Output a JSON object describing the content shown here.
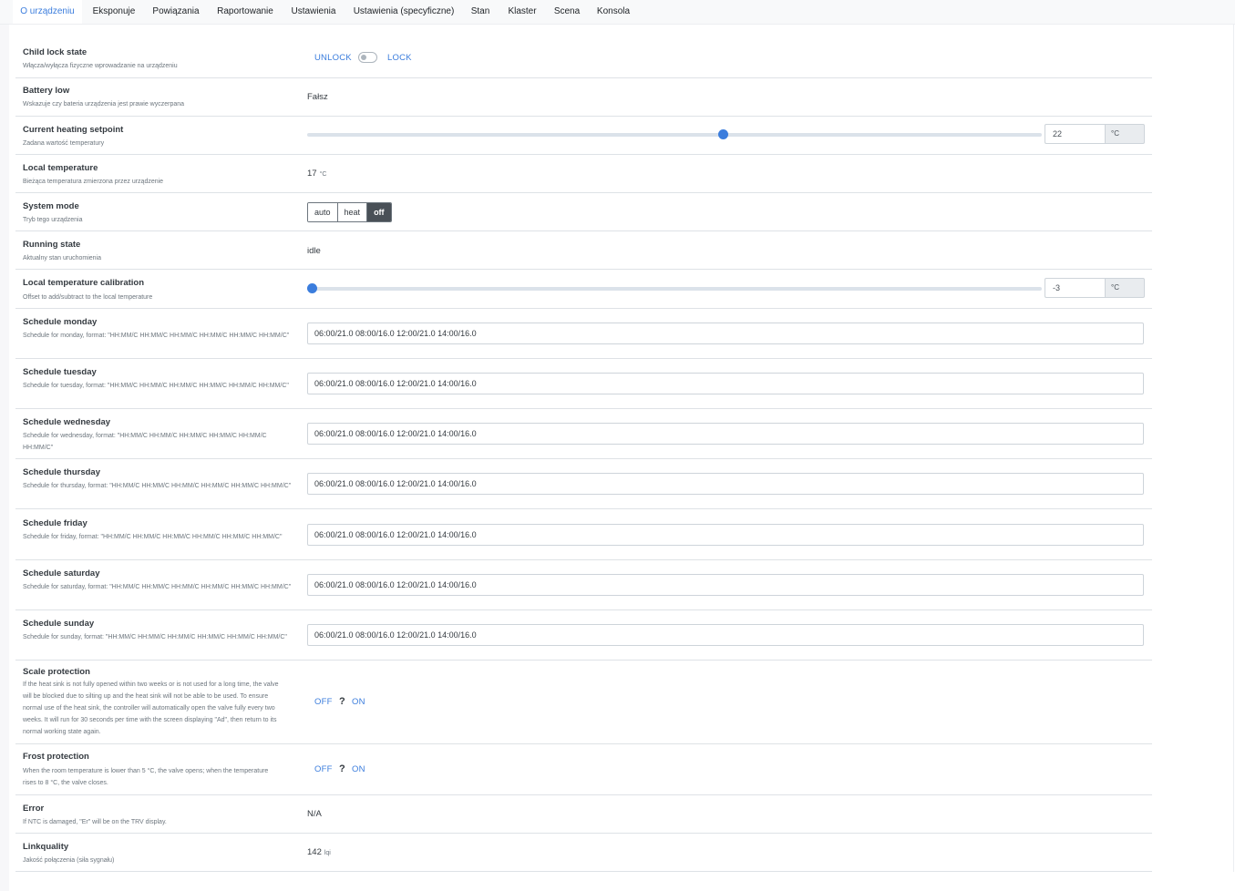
{
  "tabs": [
    "O urządzeniu",
    "Eksponuje",
    "Powiązania",
    "Raportowanie",
    "Ustawienia",
    "Ustawienia (specyficzne)",
    "Stan",
    "Klaster",
    "Scena",
    "Konsola"
  ],
  "active_tab": "O urządzeniu",
  "accent_color": "#3b7ddd",
  "child_lock": {
    "title": "Child lock state",
    "desc": "Włącza/wyłącza fizyczne wprowadzanie na urządzeniu",
    "off_label": "UNLOCK",
    "on_label": "LOCK",
    "state": "UNLOCK"
  },
  "battery_low": {
    "title": "Battery low",
    "desc": "Wskazuje czy bateria urządzenia jest prawie wyczerpana",
    "value": "Fałsz"
  },
  "heating_setpoint": {
    "title": "Current heating setpoint",
    "desc": "Zadana wartość temperatury",
    "value": "22",
    "unit": "°C",
    "slider_fraction": 0.566
  },
  "local_temperature": {
    "title": "Local temperature",
    "desc": "Bieżąca temperatura zmierzona przez urządzenie",
    "value": "17",
    "unit": "°C"
  },
  "system_mode": {
    "title": "System mode",
    "desc": "Tryb tego urządzenia",
    "options": [
      "auto",
      "heat",
      "off"
    ],
    "selected": "off"
  },
  "running_state": {
    "title": "Running state",
    "desc": "Aktualny stan uruchomienia",
    "value": "idle"
  },
  "temp_calibration": {
    "title": "Local temperature calibration",
    "desc": "Offset to add/subtract to the local temperature",
    "value": "-3",
    "unit": "°C",
    "slider_fraction": 0.006
  },
  "schedules": [
    {
      "title": "Schedule monday",
      "desc": "Schedule for monday, format: \"HH:MM/C HH:MM/C HH:MM/C HH:MM/C HH:MM/C HH:MM/C\"",
      "value": "06:00/21.0 08:00/16.0 12:00/21.0 14:00/16.0"
    },
    {
      "title": "Schedule tuesday",
      "desc": "Schedule for tuesday, format: \"HH:MM/C HH:MM/C HH:MM/C HH:MM/C HH:MM/C HH:MM/C\"",
      "value": "06:00/21.0 08:00/16.0 12:00/21.0 14:00/16.0"
    },
    {
      "title": "Schedule wednesday",
      "desc": "Schedule for wednesday, format: \"HH:MM/C HH:MM/C HH:MM/C HH:MM/C HH:MM/C HH:MM/C\"",
      "value": "06:00/21.0 08:00/16.0 12:00/21.0 14:00/16.0"
    },
    {
      "title": "Schedule thursday",
      "desc": "Schedule for thursday, format: \"HH:MM/C HH:MM/C HH:MM/C HH:MM/C HH:MM/C HH:MM/C\"",
      "value": "06:00/21.0 08:00/16.0 12:00/21.0 14:00/16.0"
    },
    {
      "title": "Schedule friday",
      "desc": "Schedule for friday, format: \"HH:MM/C HH:MM/C HH:MM/C HH:MM/C HH:MM/C HH:MM/C\"",
      "value": "06:00/21.0 08:00/16.0 12:00/21.0 14:00/16.0"
    },
    {
      "title": "Schedule saturday",
      "desc": "Schedule for saturday, format: \"HH:MM/C HH:MM/C HH:MM/C HH:MM/C HH:MM/C HH:MM/C\"",
      "value": "06:00/21.0 08:00/16.0 12:00/21.0 14:00/16.0"
    },
    {
      "title": "Schedule sunday",
      "desc": "Schedule for sunday, format: \"HH:MM/C HH:MM/C HH:MM/C HH:MM/C HH:MM/C HH:MM/C\"",
      "value": "06:00/21.0 08:00/16.0 12:00/21.0 14:00/16.0"
    }
  ],
  "scale_protection": {
    "title": "Scale protection",
    "desc": "If the heat sink is not fully opened within two weeks or is not used for a long time, the valve will be blocked due to silting up and the heat sink will not be able to be used. To ensure normal use of the heat sink, the controller will automatically open the valve fully every two weeks. It will run for 30 seconds per time with the screen displaying \"Ad\", then return to its normal working state again.",
    "off_label": "OFF",
    "on_label": "ON",
    "state_symbol": "?"
  },
  "frost_protection": {
    "title": "Frost protection",
    "desc": "When the room temperature is lower than 5 °C, the valve opens; when the temperature rises to 8 °C, the valve closes.",
    "off_label": "OFF",
    "on_label": "ON",
    "state_symbol": "?"
  },
  "error": {
    "title": "Error",
    "desc": "If NTC is damaged, \"Er\" will be on the TRV display.",
    "value": "N/A"
  },
  "linkquality": {
    "title": "Linkquality",
    "desc": "Jakość połączenia (siła sygnału)",
    "value": "142",
    "unit": "lqi"
  }
}
